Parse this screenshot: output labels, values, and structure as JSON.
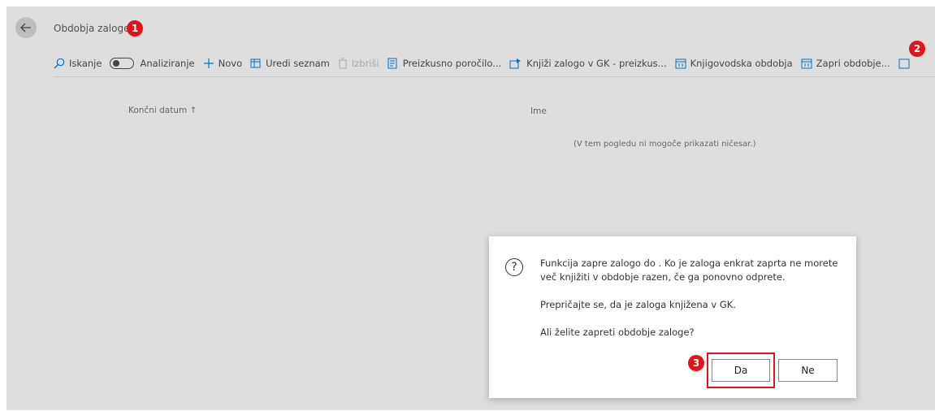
{
  "header": {
    "title": "Obdobja zaloge"
  },
  "toolbar": {
    "search": "Iskanje",
    "analyze": "Analiziranje",
    "new": "Novo",
    "edit_list": "Uredi seznam",
    "delete": "Izbriši",
    "test_report": "Preizkusno poročilo...",
    "post_test": "Knjiži zalogo v GK - preizkus...",
    "accounting_periods": "Knjigovodska obdobja",
    "close_period": "Zapri obdobje..."
  },
  "list": {
    "col_end_date": "Končni datum ↑",
    "col_name": "Ime",
    "empty_message": "(V tem pogledu ni mogoče prikazati ničesar.)"
  },
  "dialog": {
    "message_1": "Funkcija zapre zalogo do . Ko je zaloga enkrat zaprta ne morete več knjižiti v obdobje razen, če ga ponovno odprete.",
    "message_2": "Prepričajte se, da je zaloga knjižena v GK.",
    "question": "Ali želite zapreti obdobje zaloge?",
    "yes_label": "Da",
    "no_label": "Ne"
  },
  "annotations": {
    "badge_1": "1",
    "badge_2": "2",
    "badge_3": "3"
  },
  "colors": {
    "accent": "#e3131b",
    "background": "#dedede",
    "dialog": "#ffffff"
  }
}
